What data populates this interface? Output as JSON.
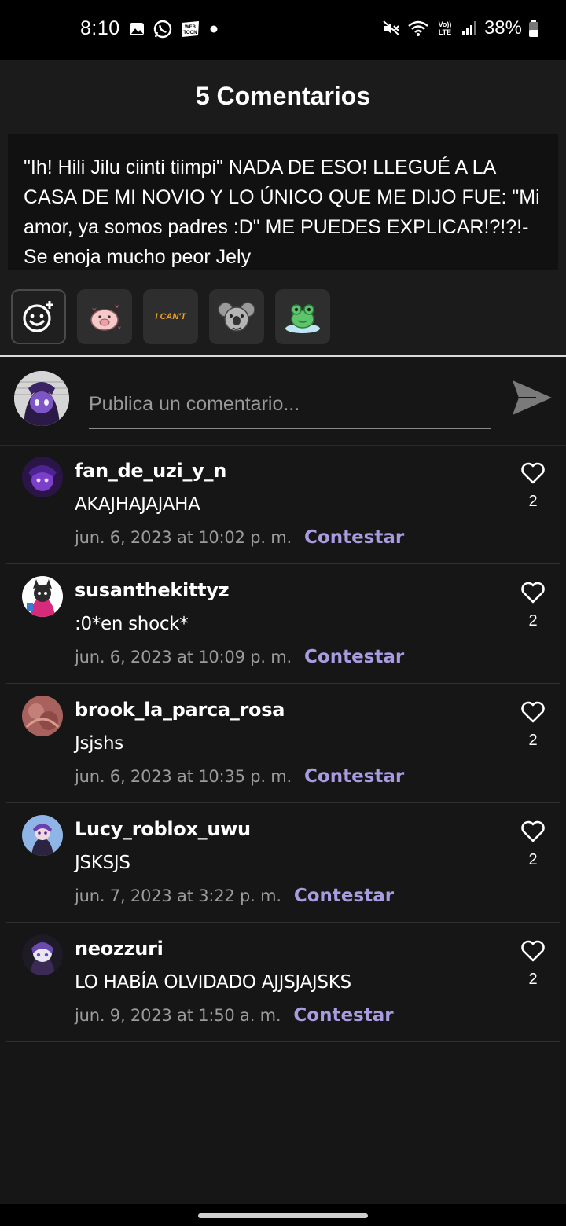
{
  "status_bar": {
    "time": "8:10",
    "battery": "38%",
    "left_icons": [
      "gallery-icon",
      "whatsapp-icon",
      "webtoon-icon",
      "dot-icon"
    ],
    "right_icons": [
      "mute-icon",
      "wifi-icon",
      "volte-icon",
      "signal-icon",
      "battery-icon"
    ],
    "volte_label": "Vo)) LTE",
    "webtoon_label": "WEB TOON"
  },
  "header": {
    "title": "5 Comentarios"
  },
  "quote": {
    "text": "\"Ih!  Hili Jilu ciinti tiimpi\" NADA DE ESO! LLEGUÉ A LA CASA DE MI NOVIO Y LO ÚNICO QUE ME DIJO FUE: \"Mi amor, ya somos padres :D\" ME PUEDES EXPLICAR!?!?!-Se enoja mucho peor Jely"
  },
  "stickers": {
    "items": [
      "add-emoji-icon",
      "pig-sticker",
      "i-cant-sticker",
      "koala-sticker",
      "frog-sticker"
    ],
    "i_cant_label": "I CAN'T"
  },
  "compose": {
    "placeholder": "Publica un comentario..."
  },
  "comments": [
    {
      "user": "fan_de_uzi_y_n",
      "text": "AKAJHAJAJAHA",
      "date": "jun. 6, 2023 at 10:02 p. m.",
      "reply": "Contestar",
      "likes": "2"
    },
    {
      "user": "susanthekittyz",
      "text": ":0*en shock*",
      "date": "jun. 6, 2023 at 10:09 p. m.",
      "reply": "Contestar",
      "likes": "2"
    },
    {
      "user": "brook_la_parca_rosa",
      "text": "Jsjshs",
      "date": "jun. 6, 2023 at 10:35 p. m.",
      "reply": "Contestar",
      "likes": "2"
    },
    {
      "user": "Lucy_roblox_uwu",
      "text": "JSKSJS",
      "date": "jun. 7, 2023 at 3:22 p. m.",
      "reply": "Contestar",
      "likes": "2"
    },
    {
      "user": "neozzuri",
      "text": "LO HABÍA OLVIDADO AJJSJAJSKS",
      "date": "jun. 9, 2023 at 1:50 a. m.",
      "reply": "Contestar",
      "likes": "2"
    }
  ],
  "colors": {
    "background": "#161616",
    "reply_accent": "#a99bdf",
    "date_text": "#9b9b9b"
  }
}
